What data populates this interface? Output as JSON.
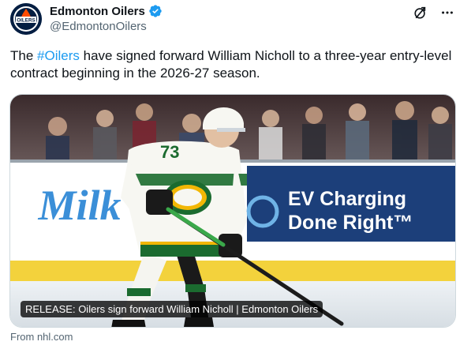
{
  "author": {
    "display_name": "Edmonton Oilers",
    "handle": "@EdmontonOilers",
    "avatar_text": "OILERS"
  },
  "tweet": {
    "text_before": "The ",
    "hashtag": "#Oilers",
    "text_after": " have signed forward William Nicholl to a three-year entry-level contract beginning in the 2026-27 season."
  },
  "media": {
    "caption": "RELEASE: Oilers sign forward William Nicholl | Edmonton Oilers",
    "ad_boards": {
      "left": "Milk",
      "right_line1": "EV Charging",
      "right_line2": "Done Right™"
    },
    "jersey_number": "73"
  },
  "card": {
    "source": "From nhl.com"
  },
  "colors": {
    "accent": "#1d9bf0",
    "oilers_navy": "#041e42",
    "oilers_orange": "#ff4c00",
    "jersey_green": "#1b6b2f",
    "jersey_gold": "#f2b705"
  },
  "icons": {
    "verified": "verified-badge-icon",
    "grok": "grok-icon",
    "more": "more-icon"
  }
}
